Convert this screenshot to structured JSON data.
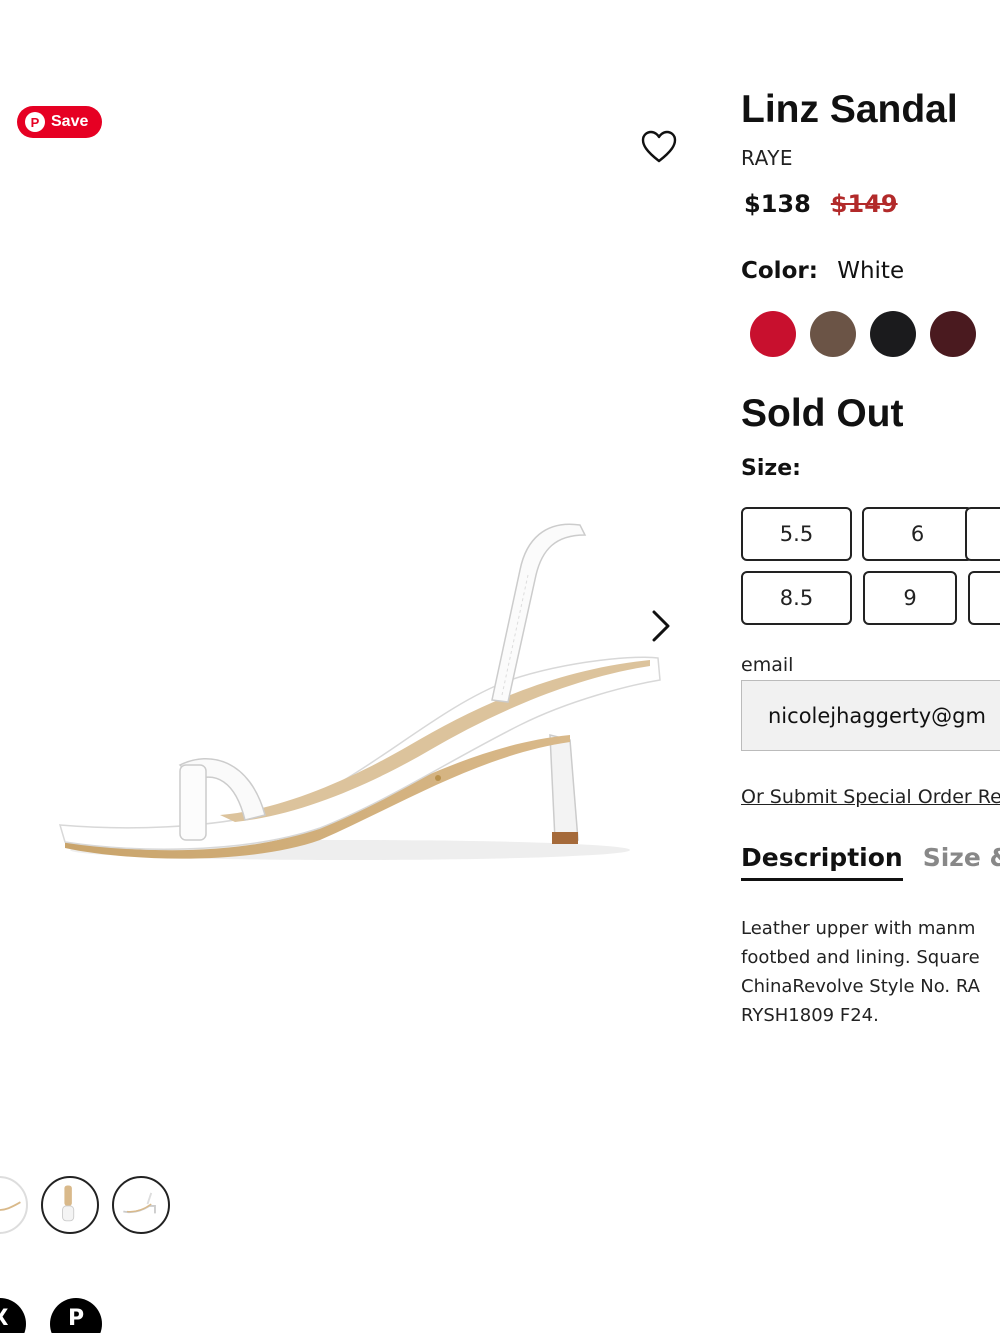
{
  "gallery": {
    "pin_save_label": "Save",
    "pin_logo_glyph": "P",
    "thumbnails_count_visible": 3,
    "social": {
      "x_glyph": "X",
      "pinterest_glyph": "P"
    }
  },
  "product": {
    "title": "Linz Sandal",
    "brand": "RAYE",
    "price": "$138",
    "original_price": "$149",
    "color_label": "Color:",
    "color_value": "White",
    "swatches": [
      {
        "name": "red",
        "color": "#c8102e"
      },
      {
        "name": "brown",
        "color": "#6b5446"
      },
      {
        "name": "black",
        "color": "#1b1b1d"
      },
      {
        "name": "burgundy",
        "color": "#4a1a1f"
      }
    ],
    "status": "Sold Out",
    "size_label": "Size:",
    "sizes": [
      "5.5",
      "6",
      "8.5",
      "9"
    ],
    "email_label": "email",
    "email_value": "nicolejhaggerty@gm",
    "special_order_link": "Or Submit Special Order Re",
    "tabs": [
      "Description",
      "Size &"
    ],
    "description_lines": [
      "Leather upper with manm",
      "footbed and lining. Square",
      "ChinaRevolve Style No. RA",
      "RYSH1809 F24."
    ]
  }
}
